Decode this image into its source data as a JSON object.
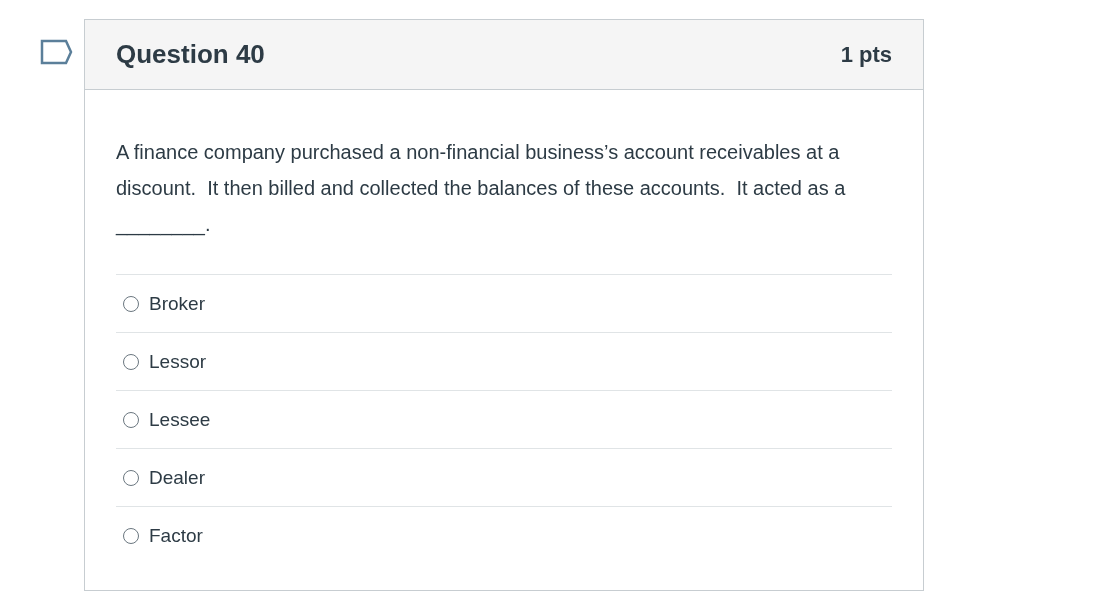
{
  "question": {
    "flagged": false,
    "title": "Question 40",
    "points": "1 pts",
    "text": "A finance company purchased a non-financial business’s account receivables at a discount.  It then billed and collected the balances of these accounts.  It acted as a ________.",
    "answers": [
      {
        "label": "Broker",
        "selected": false
      },
      {
        "label": "Lessor",
        "selected": false
      },
      {
        "label": "Lessee",
        "selected": false
      },
      {
        "label": "Dealer",
        "selected": false
      },
      {
        "label": "Factor",
        "selected": false
      }
    ]
  }
}
